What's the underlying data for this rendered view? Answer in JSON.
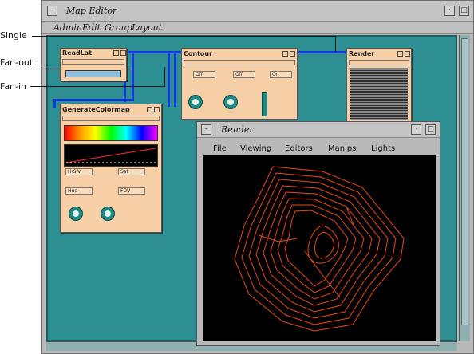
{
  "callouts": {
    "single": "Single",
    "fan_out": "Fan-out",
    "fan_in": "Fan-in"
  },
  "window": {
    "title": "Map Editor",
    "menus": [
      "Admin",
      "Edit",
      "Group",
      "Layout"
    ]
  },
  "modules": {
    "readlat": {
      "title": "ReadLat",
      "button_label": ""
    },
    "contour": {
      "title": "Contour",
      "options": [
        "Off",
        "Off",
        "On"
      ]
    },
    "render_module": {
      "title": "Render"
    },
    "colormap": {
      "title": "GenerateColormap",
      "options": [
        "H-S-V",
        "Sat",
        "Hue",
        "FOV"
      ]
    }
  },
  "render": {
    "title": "Render",
    "menus": [
      "File",
      "Viewing",
      "Editors",
      "Manips",
      "Lights"
    ]
  },
  "colors": {
    "canvas": "#2e8f92",
    "module": "#f6cfa6",
    "wire": "#1239e0",
    "contour": "#e84a1a"
  }
}
